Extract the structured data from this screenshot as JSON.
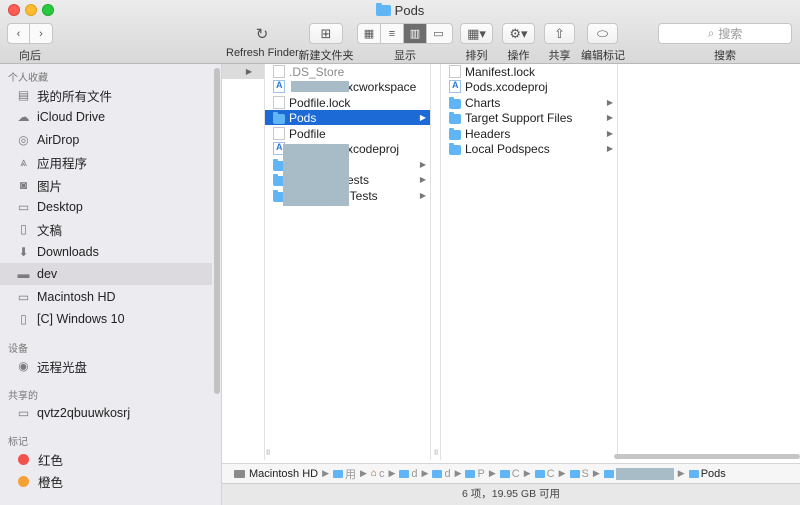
{
  "window": {
    "title": "Pods"
  },
  "toolbar": {
    "back_label": "向后",
    "refresh_label": "Refresh Finder",
    "new_folder_label": "新建文件夹",
    "view_label": "显示",
    "sort_label": "排列",
    "action_label": "操作",
    "share_label": "共享",
    "tags_label": "编辑标记",
    "search_label": "搜索",
    "search_placeholder": "搜索"
  },
  "sidebar": {
    "favorites_header": "个人收藏",
    "favorites": [
      {
        "label": "我的所有文件",
        "icon": "all-files-icon"
      },
      {
        "label": "iCloud Drive",
        "icon": "cloud-icon"
      },
      {
        "label": "AirDrop",
        "icon": "airdrop-icon"
      },
      {
        "label": "应用程序",
        "icon": "applications-icon"
      },
      {
        "label": "图片",
        "icon": "camera-icon"
      },
      {
        "label": "Desktop",
        "icon": "desktop-icon"
      },
      {
        "label": "文稿",
        "icon": "document-icon"
      },
      {
        "label": "Downloads",
        "icon": "download-icon"
      },
      {
        "label": "dev",
        "icon": "folder-icon",
        "selected": true
      },
      {
        "label": "Macintosh HD",
        "icon": "hard-drive-icon"
      },
      {
        "label": "[C] Windows 10",
        "icon": "hard-drive-icon"
      }
    ],
    "devices_header": "设备",
    "devices": [
      {
        "label": "远程光盘",
        "icon": "disc-icon"
      }
    ],
    "shared_header": "共享的",
    "shared": [
      {
        "label": "qvtz2qbuuwkosrj",
        "icon": "computer-icon"
      }
    ],
    "tags_header": "标记",
    "tags": [
      {
        "label": "红色",
        "color": "#f1524d"
      },
      {
        "label": "橙色",
        "color": "#f6a135"
      }
    ]
  },
  "columns": {
    "col2": [
      {
        "name": ".DS_Store",
        "type": "doc",
        "dimmed": true
      },
      {
        "name": "xcworkspace",
        "type": "proj",
        "redacted": true
      },
      {
        "name": "Podfile.lock",
        "type": "doc"
      },
      {
        "name": "Pods",
        "type": "folder",
        "selected": true,
        "has_children": true
      },
      {
        "name": "Podfile",
        "type": "doc"
      },
      {
        "name": "xcodeproj",
        "type": "proj",
        "redacted": true
      },
      {
        "name": "",
        "type": "folder",
        "redacted": true,
        "has_children": true
      },
      {
        "name": "ests",
        "type": "folder",
        "redacted": true,
        "has_children": true
      },
      {
        "name": "lTests",
        "type": "folder",
        "redacted": true,
        "has_children": true
      }
    ],
    "col3": [
      {
        "name": "Manifest.lock",
        "type": "doc"
      },
      {
        "name": "Pods.xcodeproj",
        "type": "proj"
      },
      {
        "name": "Charts",
        "type": "folder",
        "has_children": true
      },
      {
        "name": "Target Support Files",
        "type": "folder",
        "has_children": true
      },
      {
        "name": "Headers",
        "type": "folder",
        "has_children": true
      },
      {
        "name": "Local Podspecs",
        "type": "folder",
        "has_children": true
      }
    ]
  },
  "pathbar": {
    "root": "Macintosh HD",
    "segments": [
      "用",
      "c",
      "d",
      "d",
      "P",
      "C",
      "C",
      "S"
    ],
    "current": "Pods"
  },
  "status": {
    "text": "6 项，19.95 GB 可用"
  }
}
